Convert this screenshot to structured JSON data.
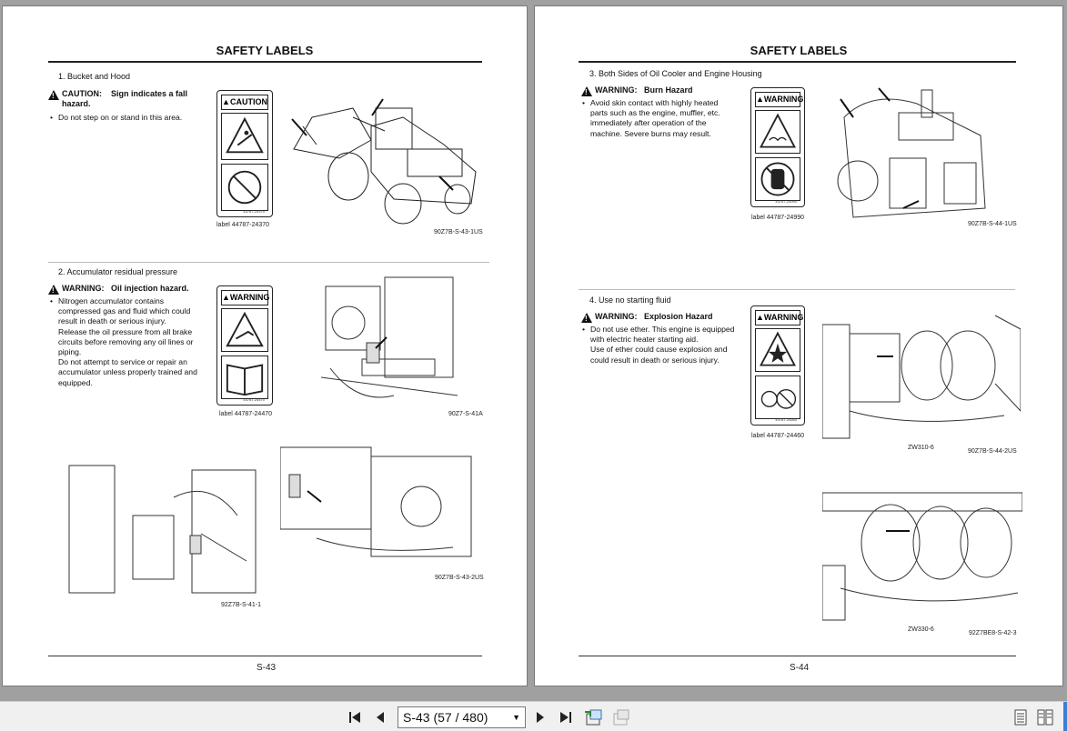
{
  "left_page": {
    "title": "SAFETY LABELS",
    "page_number": "S-43",
    "section1": {
      "title": "1.  Bucket and Hood",
      "head_kind": "CAUTION:",
      "head_text": "Sign indicates a fall",
      "head_text2": "hazard.",
      "bullet": "Do not step on or stand in this area.",
      "card_header": "CAUTION",
      "card_no": "44787-24370",
      "label_caption": "label 44787-24370",
      "figure_caption": "90Z7B-S-43-1US"
    },
    "section2": {
      "title": "2.  Accumulator residual pressure",
      "head_kind": "WARNING:",
      "head_text": "Oil injection hazard.",
      "bullet_lines": [
        "Nitrogen accumulator contains",
        "compressed gas and fluid which could",
        "result in death or serious injury.",
        "Release the oil pressure from all brake",
        "circuits before removing any oil lines or",
        "piping.",
        "Do not attempt to service or repair an",
        "accumulator unless properly trained and",
        "equipped."
      ],
      "card_header": "WARNING",
      "card_no": "44787-24470",
      "label_caption": "label 44787-24470",
      "figure_caption": "90Z7-S-41A",
      "figure2_caption": "92Z7B-S-41-1",
      "figure3_caption": "90Z7B-S-43-2US"
    }
  },
  "right_page": {
    "title": "SAFETY LABELS",
    "page_number": "S-44",
    "section3": {
      "title": "3.  Both Sides of Oil Cooler and Engine Housing",
      "head_kind": "WARNING:",
      "head_text": "Burn Hazard",
      "bullet_lines": [
        "Avoid skin contact with highly heated",
        "parts such as the engine, muffler, etc.",
        "immediately after operation of the",
        "machine. Severe burns may result."
      ],
      "card_header": "WARNING",
      "card_no": "44787-24990",
      "label_caption": "label 44787-24990",
      "figure_caption": "90Z7B-S-44-1US"
    },
    "section4": {
      "title": "4.  Use no starting fluid",
      "head_kind": "WARNING:",
      "head_text": "Explosion Hazard",
      "bullet_lines": [
        "Do not use ether. This engine is equipped",
        "with electric heater starting aid.",
        "Use of ether could cause explosion and",
        "could result in death or serious injury."
      ],
      "card_header": "WARNING",
      "card_no": "44787-24460",
      "label_caption": "label 44787-24460",
      "model1": "ZW310-6",
      "figure_caption": "90Z7B-S-44-2US",
      "model2": "ZW330-6",
      "figure2_caption": "92Z7BE8-S-42-3"
    }
  },
  "toolbar": {
    "page_select_value": "S-43 (57 / 480)"
  }
}
